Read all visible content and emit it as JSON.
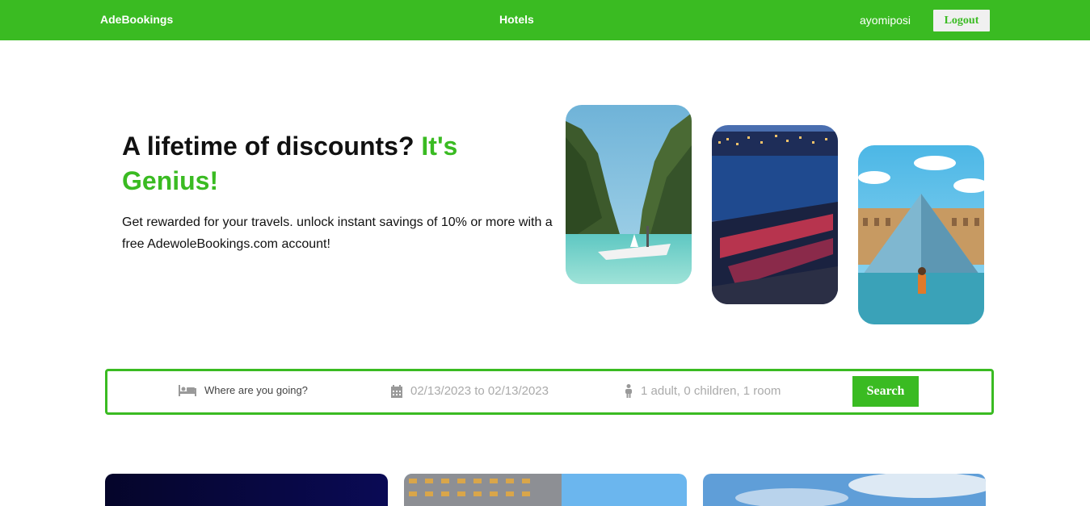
{
  "nav": {
    "brand": "AdeBookings",
    "hotels": "Hotels",
    "username": "ayomiposi",
    "logout": "Logout"
  },
  "hero": {
    "title": "A lifetime of discounts?",
    "title_accent": "It's Genius!",
    "description": "Get rewarded for your travels. unlock instant savings of 10% or more with a free AdewoleBookings.com account!"
  },
  "search": {
    "destination_placeholder": "Where are you going?",
    "dates": "02/13/2023 to 02/13/2023",
    "guests": "1 adult, 0 children, 1 room",
    "button": "Search",
    "icons": [
      "bed-icon",
      "calendar-icon",
      "person-icon"
    ]
  },
  "colors": {
    "brand_green": "#3abb22",
    "white": "#ffffff"
  }
}
